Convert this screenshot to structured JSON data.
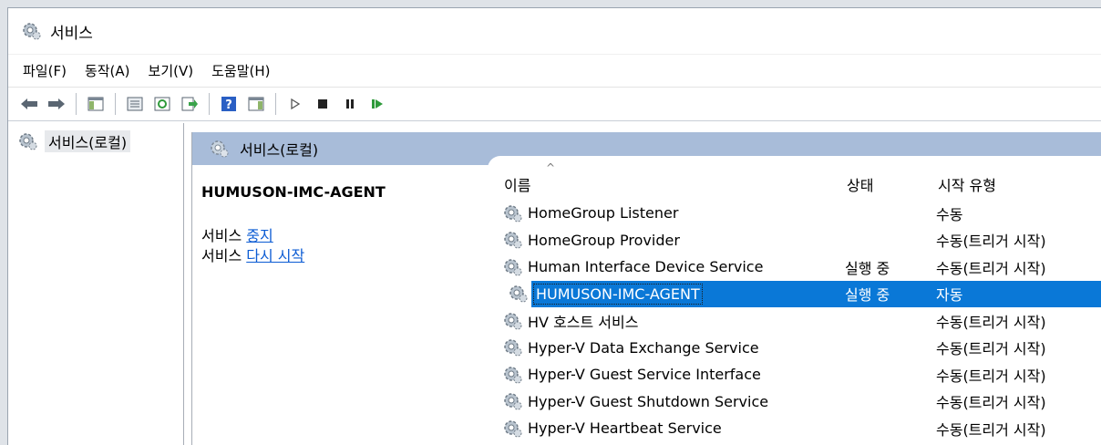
{
  "window": {
    "title": "서비스",
    "icon": "services-gear-icon"
  },
  "menu": [
    "파일(F)",
    "동작(A)",
    "보기(V)",
    "도움말(H)"
  ],
  "toolbar": {
    "buttons": [
      "back-arrow-icon",
      "forward-arrow-icon",
      "show-hide-console-tree-icon",
      "properties-icon",
      "refresh-icon",
      "export-list-icon",
      "help-icon",
      "show-action-pane-icon",
      "start-service-icon",
      "stop-service-icon",
      "pause-service-icon",
      "restart-service-icon"
    ]
  },
  "tree": {
    "root_label": "서비스(로컬)"
  },
  "pane": {
    "header": "서비스(로컬)"
  },
  "details": {
    "service_name": "HUMUSON-IMC-AGENT",
    "stop_prefix": "서비스 ",
    "stop_link": "중지",
    "restart_prefix": "서비스 ",
    "restart_link": "다시 시작"
  },
  "columns": {
    "name": "이름",
    "status": "상태",
    "startup": "시작 유형"
  },
  "services": [
    {
      "name": "HomeGroup Listener",
      "status": "",
      "startup": "수동"
    },
    {
      "name": "HomeGroup Provider",
      "status": "",
      "startup": "수동(트리거 시작)"
    },
    {
      "name": "Human Interface Device Service",
      "status": "실행 중",
      "startup": "수동(트리거 시작)"
    },
    {
      "name": "HUMUSON-IMC-AGENT",
      "status": "실행 중",
      "startup": "자동",
      "selected": true
    },
    {
      "name": "HV 호스트 서비스",
      "status": "",
      "startup": "수동(트리거 시작)"
    },
    {
      "name": "Hyper-V Data Exchange Service",
      "status": "",
      "startup": "수동(트리거 시작)"
    },
    {
      "name": "Hyper-V Guest Service Interface",
      "status": "",
      "startup": "수동(트리거 시작)"
    },
    {
      "name": "Hyper-V Guest Shutdown Service",
      "status": "",
      "startup": "수동(트리거 시작)"
    },
    {
      "name": "Hyper-V Heartbeat Service",
      "status": "",
      "startup": "수동(트리거 시작)"
    }
  ],
  "colors": {
    "selection": "#0a78d7",
    "pane_header": "#a8bcd9",
    "link": "#0b5bd3"
  }
}
